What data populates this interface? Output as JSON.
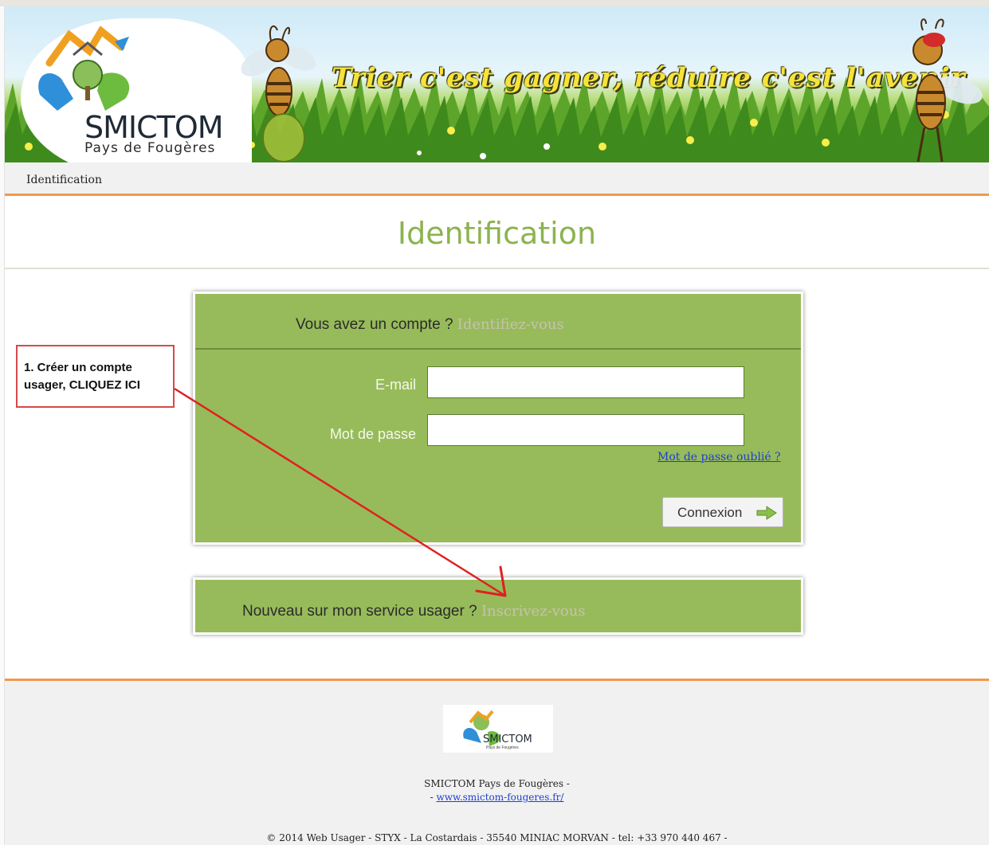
{
  "header": {
    "logo_title": "SMICTOM",
    "logo_subtitle": "Pays de Fougères",
    "slogan": "Trier c'est gagner, réduire c'est l'avenir"
  },
  "breadcrumb": {
    "current": "Identification"
  },
  "page_title": "Identification",
  "login": {
    "question": "Vous avez un compte ?",
    "question_link": "Identifiez-vous",
    "email_label": "E-mail",
    "email_value": "",
    "password_label": "Mot de passe",
    "password_value": "",
    "forgot_link": "Mot de passe oublié ?",
    "connect_label": "Connexion"
  },
  "register": {
    "question": "Nouveau sur mon service usager ?",
    "link": "Inscrivez-vous"
  },
  "annotation": {
    "text": "1. Créer un compte usager, CLIQUEZ ICI",
    "color": "#d44a4a"
  },
  "footer": {
    "logo_title": "SMICTOM",
    "logo_subtitle": "Pays de Fougères",
    "org_line": "SMICTOM Pays de Fougères -",
    "website_prefix": "- ",
    "website": "www.smictom-fougeres.fr/",
    "copyright": "© 2014 Web Usager - STYX - La Costardais - 35540 MINIAC MORVAN - tel: +33 970 440 467 -"
  },
  "colors": {
    "accent_green": "#97bb5a",
    "title_green": "#8cb34f",
    "orange_rule": "#ef9a4d",
    "link_blue": "#1d3fd1"
  }
}
